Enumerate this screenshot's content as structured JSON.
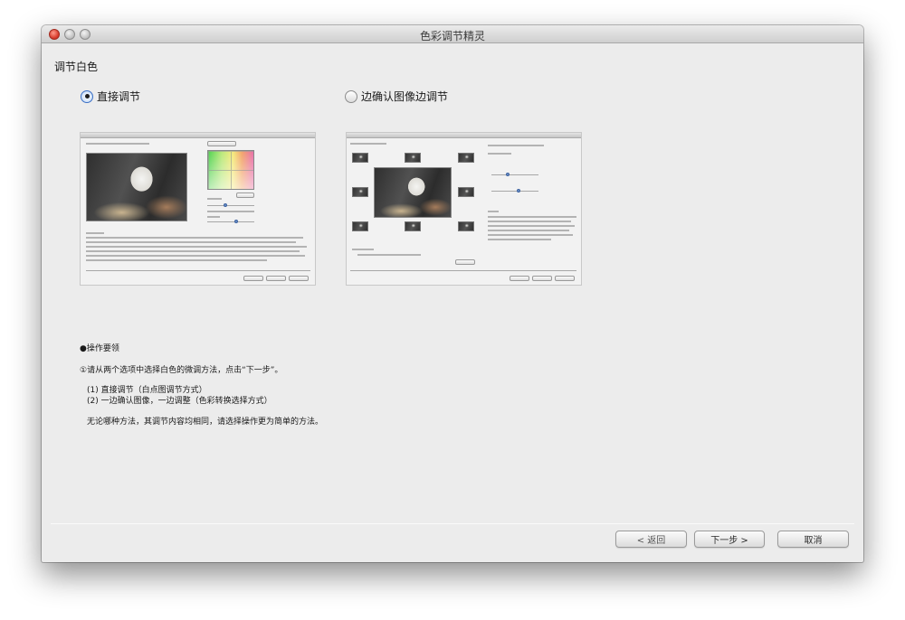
{
  "window": {
    "title": "色彩调节精灵"
  },
  "section": {
    "title": "调节白色"
  },
  "options": [
    {
      "label": "直接调节",
      "selected": true
    },
    {
      "label": "边确认图像边调节",
      "selected": false
    }
  ],
  "instructions": {
    "heading": "●操作要领",
    "step": "①请从两个选项中选择白色的微调方法，点击“下一步”。",
    "option1": "(1) 直接调节（白点图调节方式）",
    "option2": "(2) 一边确认图像，一边调整（色彩转换选择方式）",
    "note": "无论哪种方法，其调节内容均相同，请选择操作更为简单的方法。"
  },
  "buttons": {
    "back": "< 返回",
    "next": "下一步 >",
    "cancel": "取消"
  },
  "colors": {
    "window_bg": "#ececec",
    "radio_accent": "#3a6fc4",
    "close_button": "#d6392a"
  }
}
